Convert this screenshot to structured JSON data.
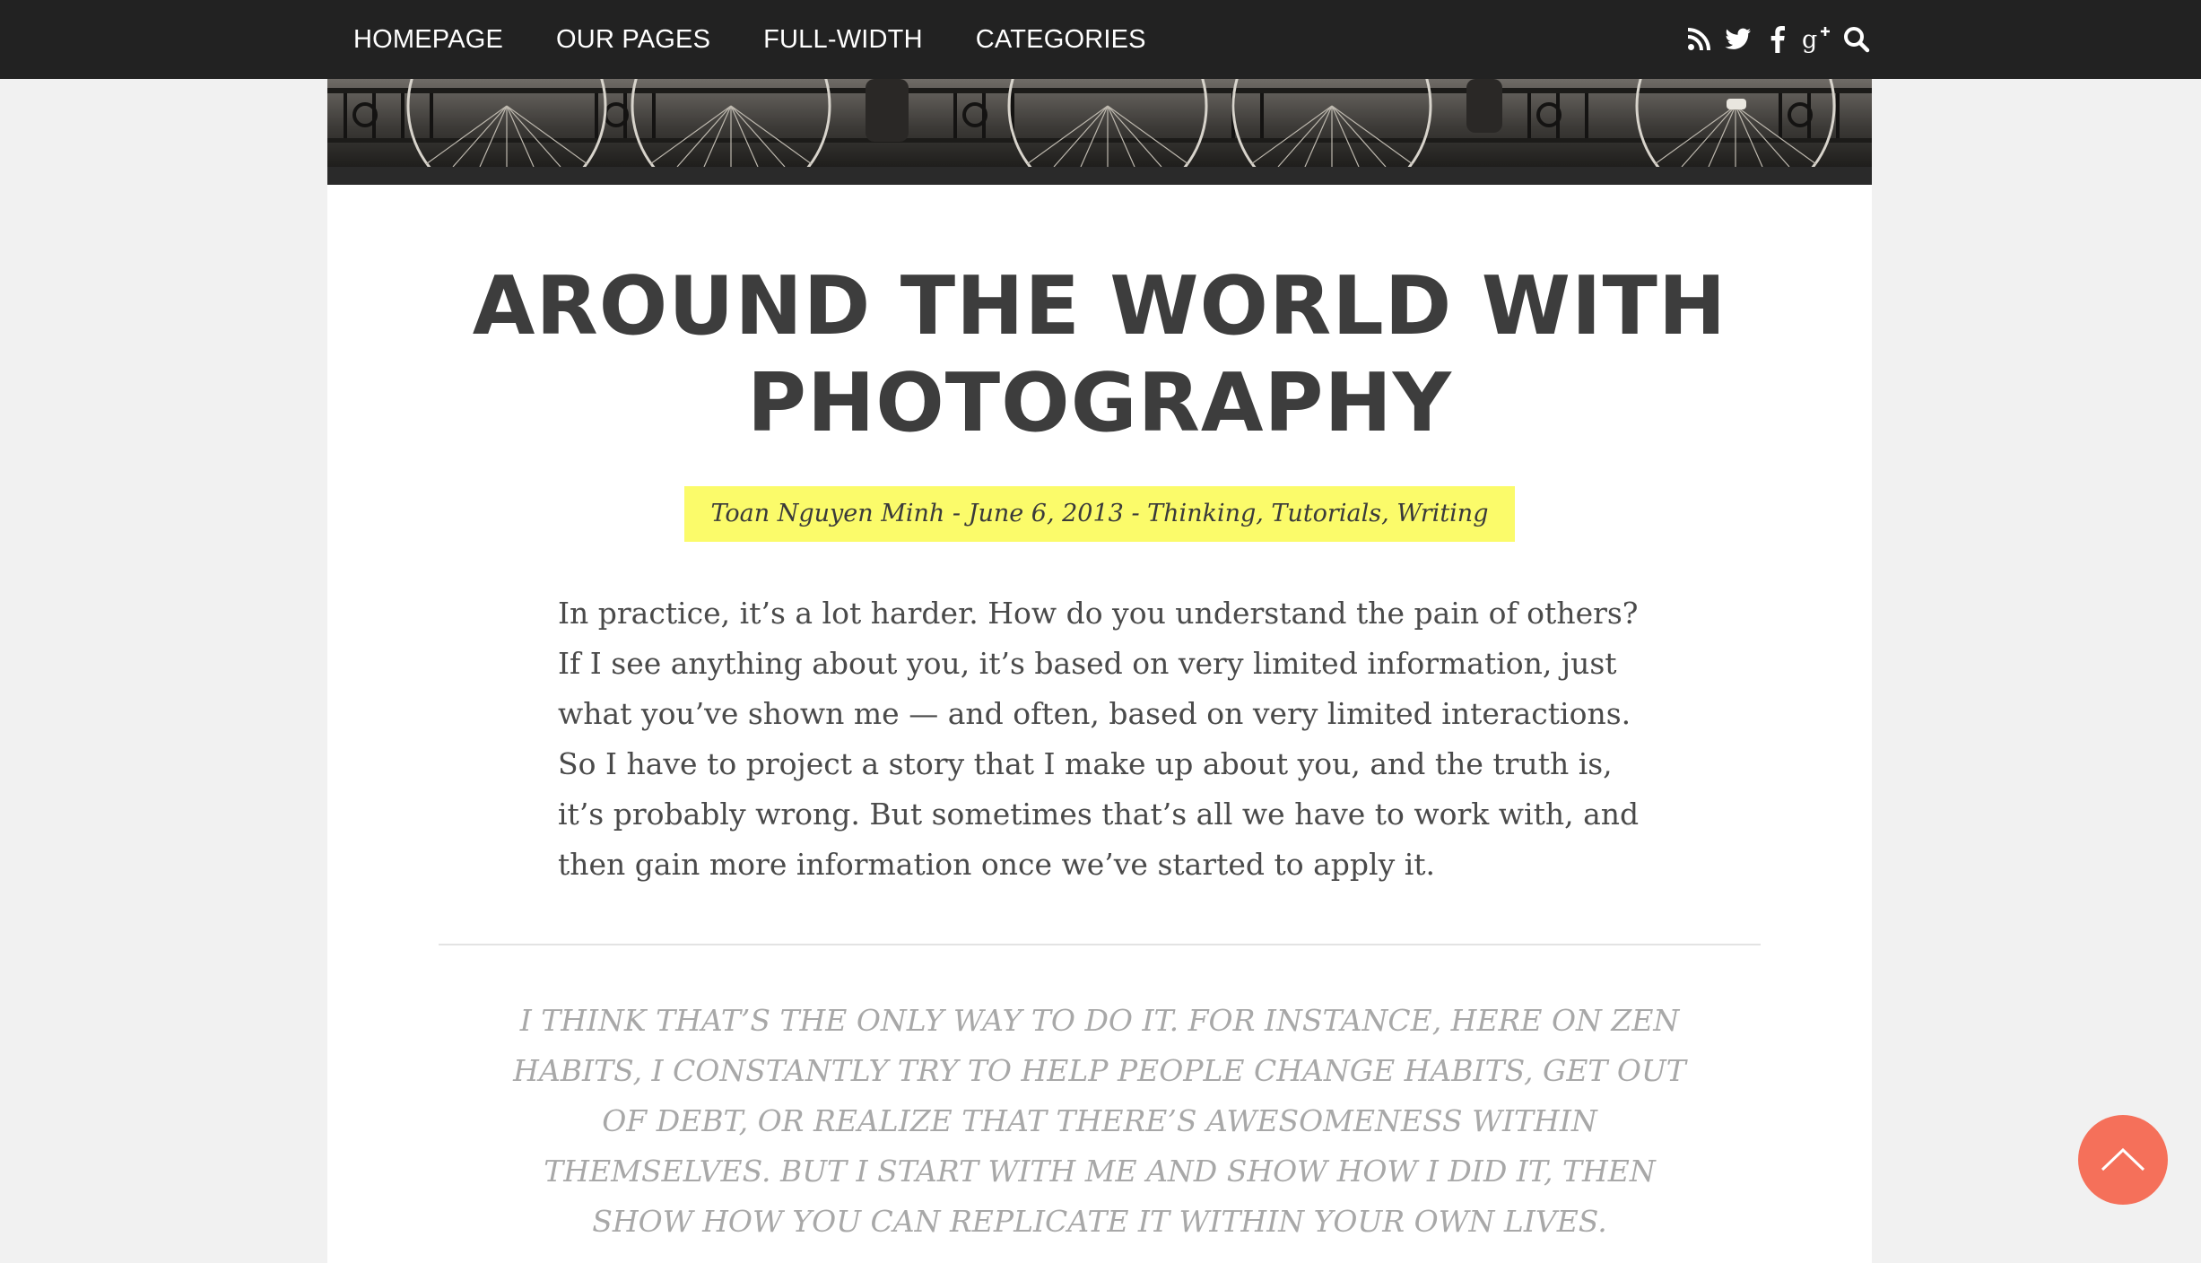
{
  "nav": {
    "items": [
      {
        "label": "HOMEPAGE"
      },
      {
        "label": "OUR PAGES"
      },
      {
        "label": "FULL-WIDTH"
      },
      {
        "label": "CATEGORIES"
      }
    ],
    "social_icons": [
      "rss-icon",
      "twitter-icon",
      "facebook-icon",
      "google-plus-icon",
      "search-icon"
    ]
  },
  "post": {
    "title": "AROUND THE WORLD WITH PHOTOGRAPHY",
    "meta": {
      "author": "Toan Nguyen Minh",
      "separator": " - ",
      "date": "June 6, 2013",
      "categories": [
        "Thinking",
        "Tutorials",
        "Writing"
      ]
    },
    "body": "In practice, it’s a lot harder. How do you understand the pain of others? If I see anything about you, it’s based on very limited information, just what you’ve shown me — and often, based on very limited interactions. So I have to project a story that I make up about you, and the truth is, it’s probably wrong. But sometimes that’s all we have to work with, and then gain more information once we’ve started to apply it.",
    "quote": "I THINK THAT’S THE ONLY WAY TO DO IT. FOR INSTANCE, HERE ON ZEN HABITS, I CONSTANTLY TRY TO HELP PEOPLE CHANGE HABITS, GET OUT OF DEBT, OR REALIZE THAT THERE’S AWESOMENESS WITHIN THEMSELVES. BUT I START WITH ME AND SHOW HOW I DID IT, THEN SHOW HOW YOU CAN REPLICATE IT WITHIN YOUR OWN LIVES."
  },
  "colors": {
    "topbar": "#222222",
    "page_bg": "#f1f1f1",
    "meta_highlight": "#fbfb6a",
    "back_to_top": "#f5705a",
    "title_text": "#3d3d3d"
  },
  "back_to_top": {
    "icon": "chevron-up-icon"
  }
}
